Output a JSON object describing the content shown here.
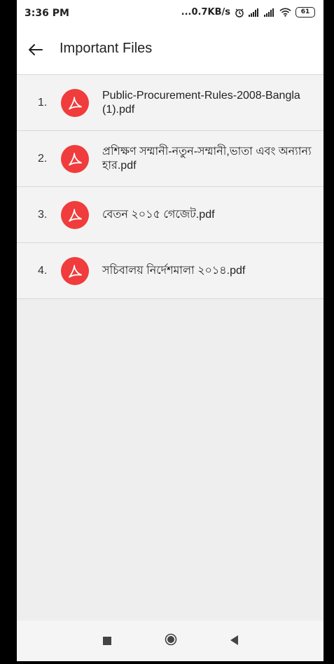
{
  "status_bar": {
    "time": "3:36 PM",
    "speed": "...0.7KB/s",
    "battery": "61"
  },
  "app_bar": {
    "title": "Important Files"
  },
  "files": [
    {
      "number": "1.",
      "name": "Public-Procurement-Rules-2008-Bangla (1).pdf"
    },
    {
      "number": "2.",
      "name": "প্রশিক্ষণ সম্মানী-নতুন-সম্মানী,ভাতা এবং অন্যান্য হার.pdf"
    },
    {
      "number": "3.",
      "name": "বেতন ২০১৫ গেজেট.pdf"
    },
    {
      "number": "4.",
      "name": "সচিবালয় নির্দেশমালা ২০১৪.pdf"
    }
  ],
  "icons": {
    "file": "pdf-icon",
    "back": "arrow-left-icon",
    "nav": [
      "recents-icon",
      "home-icon",
      "back-icon"
    ]
  },
  "colors": {
    "pdf_accent": "#f03c3c"
  }
}
